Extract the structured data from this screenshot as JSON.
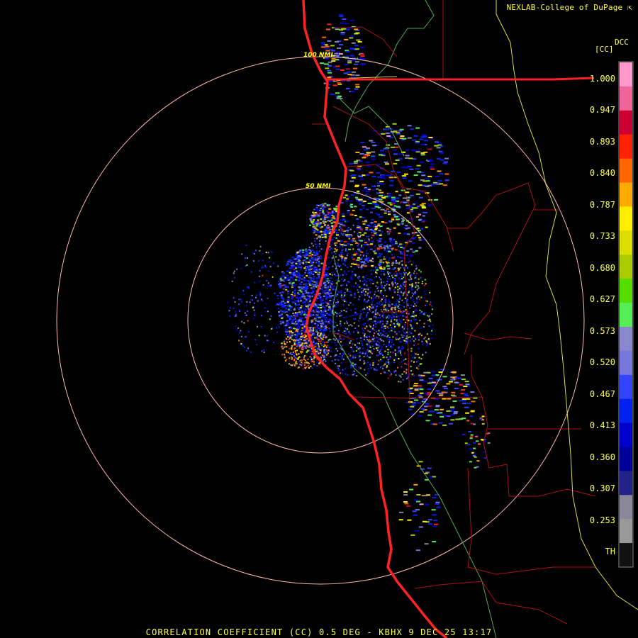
{
  "credit": "NEXLAB-College of DuPage",
  "credit_icon": "cursor-arrow-icon",
  "legend": {
    "product_code": "DCC",
    "unit": "[CC]",
    "ticks": [
      "1.000",
      "0.947",
      "0.893",
      "0.840",
      "0.787",
      "0.733",
      "0.680",
      "0.627",
      "0.573",
      "0.520",
      "0.467",
      "0.413",
      "0.360",
      "0.307",
      "0.253",
      "TH"
    ],
    "colors": [
      "#ff99cc",
      "#ee6699",
      "#cc0033",
      "#ff2200",
      "#ff6600",
      "#ffaa00",
      "#ffee00",
      "#dddd00",
      "#aacc00",
      "#55dd00",
      "#55ee55",
      "#8888cc",
      "#7777dd",
      "#3344ff",
      "#0022ee",
      "#0000cc",
      "#000099",
      "#222288",
      "#888899",
      "#999999",
      "#111111"
    ]
  },
  "rings": [
    {
      "label": "100 NMI",
      "range_nmi": 100
    },
    {
      "label": "50 NMI",
      "range_nmi": 50
    }
  ],
  "product_title": "CORRELATION COEFFICIENT (CC) 0.5 DEG - KBHX 9 DEC 25 13:17",
  "colors": {
    "coast": "#ff2222",
    "county": "#aa1111",
    "state": "#dddd44",
    "river": "#55aa55",
    "ring": "#ffbbaa",
    "text": "#ffff44"
  }
}
